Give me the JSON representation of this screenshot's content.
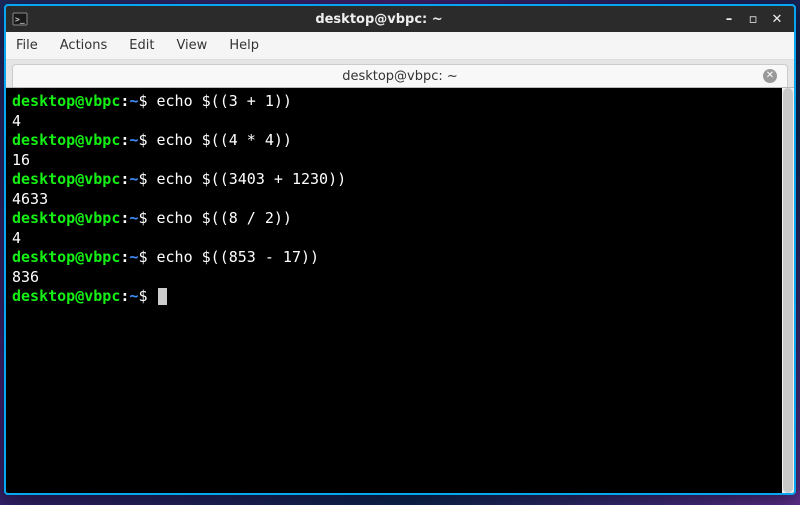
{
  "titlebar": {
    "title": "desktop@vbpc: ~"
  },
  "menubar": {
    "items": [
      "File",
      "Actions",
      "Edit",
      "View",
      "Help"
    ]
  },
  "tabbar": {
    "tab_label": "desktop@vbpc: ~"
  },
  "prompt": {
    "user": "desktop",
    "at": "@",
    "host": "vbpc",
    "colon": ":",
    "path": "~",
    "dollar": "$ "
  },
  "session": [
    {
      "type": "cmd",
      "text": "echo $((3 + 1))"
    },
    {
      "type": "out",
      "text": "4"
    },
    {
      "type": "cmd",
      "text": "echo $((4 * 4))"
    },
    {
      "type": "out",
      "text": "16"
    },
    {
      "type": "cmd",
      "text": "echo $((3403 + 1230))"
    },
    {
      "type": "out",
      "text": "4633"
    },
    {
      "type": "cmd",
      "text": "echo $((8 / 2))"
    },
    {
      "type": "out",
      "text": "4"
    },
    {
      "type": "cmd",
      "text": "echo $((853 - 17))"
    },
    {
      "type": "out",
      "text": "836"
    },
    {
      "type": "cmd",
      "text": "",
      "cursor": true
    }
  ]
}
